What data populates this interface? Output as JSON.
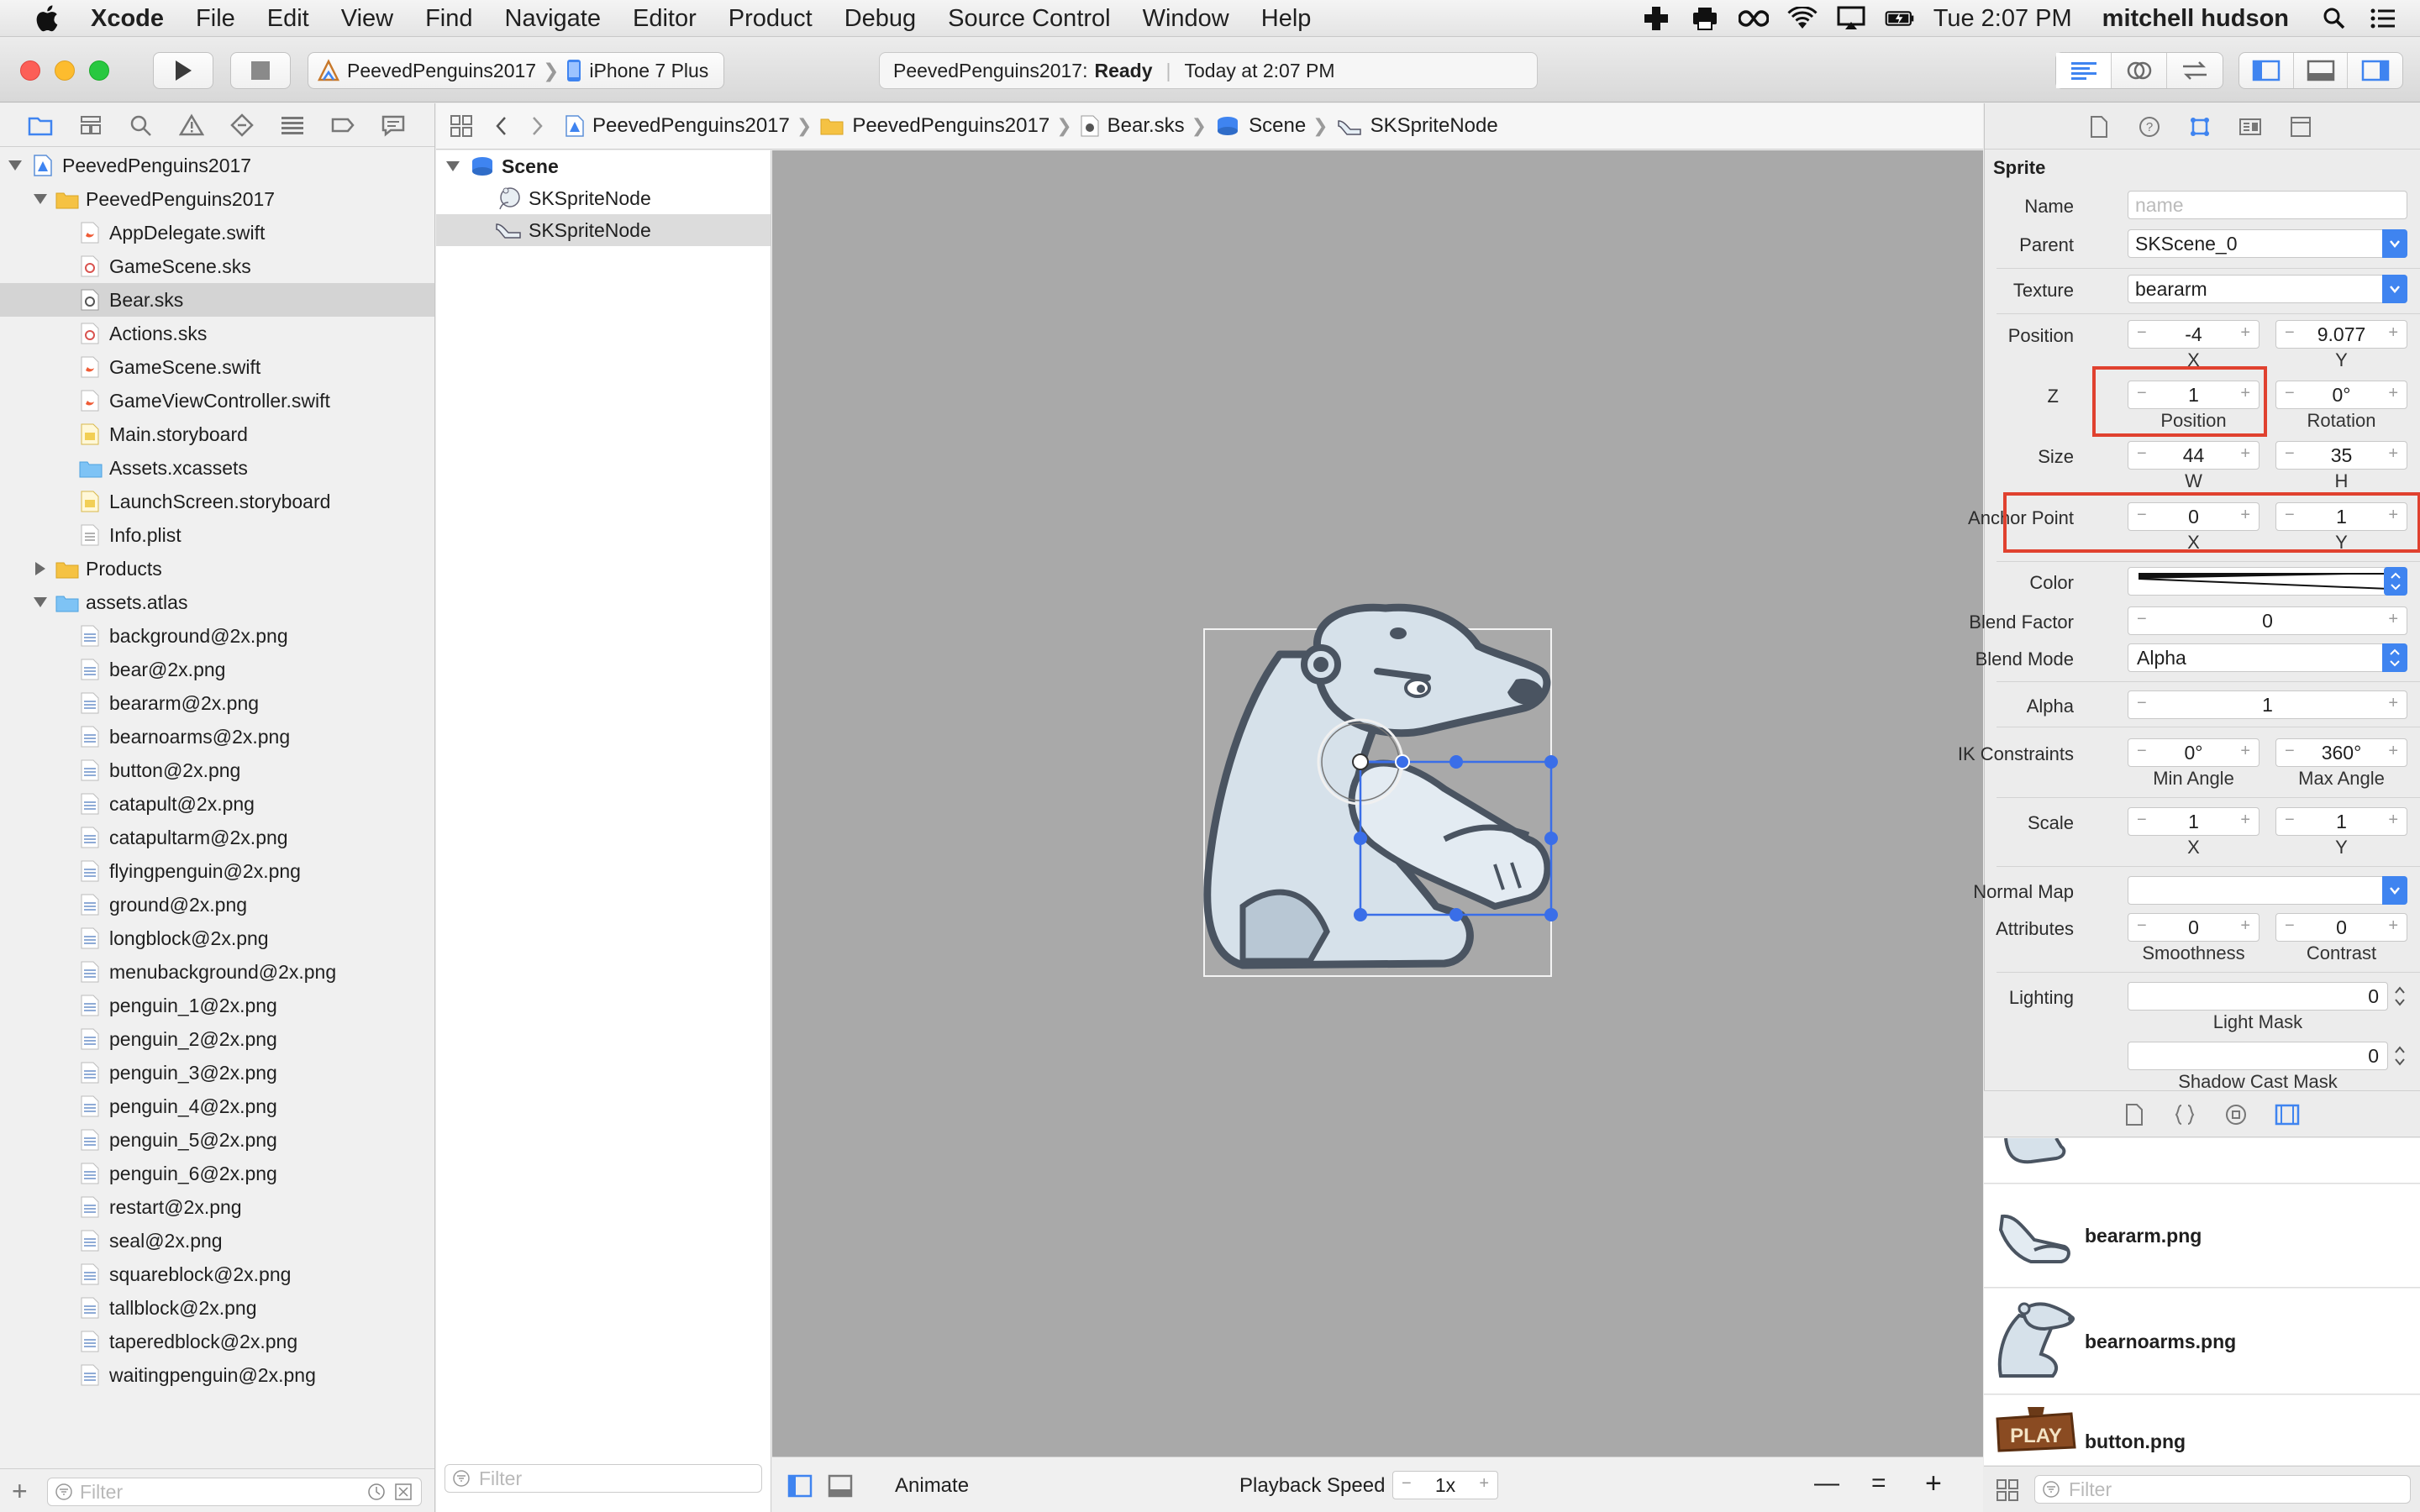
{
  "menubar": {
    "app_name": "Xcode",
    "menus": [
      "File",
      "Edit",
      "View",
      "Find",
      "Navigate",
      "Editor",
      "Product",
      "Debug",
      "Source Control",
      "Window",
      "Help"
    ],
    "clock": "Tue 2:07 PM",
    "user": "mitchell hudson"
  },
  "toolbar": {
    "scheme_project": "PeevedPenguins2017",
    "scheme_device": "iPhone 7 Plus",
    "activity_project": "PeevedPenguins2017:",
    "activity_status": "Ready",
    "activity_time": "Today at 2:07 PM"
  },
  "navigator": {
    "project": "PeevedPenguins2017",
    "group": "PeevedPenguins2017",
    "files": [
      {
        "name": "AppDelegate.swift",
        "kind": "swift"
      },
      {
        "name": "GameScene.sks",
        "kind": "sks"
      },
      {
        "name": "Bear.sks",
        "kind": "sks"
      },
      {
        "name": "Actions.sks",
        "kind": "sks"
      },
      {
        "name": "GameScene.swift",
        "kind": "swift"
      },
      {
        "name": "GameViewController.swift",
        "kind": "swift"
      },
      {
        "name": "Main.storyboard",
        "kind": "storyboard"
      },
      {
        "name": "Assets.xcassets",
        "kind": "assets"
      },
      {
        "name": "LaunchScreen.storyboard",
        "kind": "storyboard"
      },
      {
        "name": "Info.plist",
        "kind": "plist"
      }
    ],
    "products": "Products",
    "atlas": "assets.atlas",
    "atlas_files": [
      "background@2x.png",
      "bear@2x.png",
      "beararm@2x.png",
      "bearnoarms@2x.png",
      "button@2x.png",
      "catapult@2x.png",
      "catapultarm@2x.png",
      "flyingpenguin@2x.png",
      "ground@2x.png",
      "longblock@2x.png",
      "menubackground@2x.png",
      "penguin_1@2x.png",
      "penguin_2@2x.png",
      "penguin_3@2x.png",
      "penguin_4@2x.png",
      "penguin_5@2x.png",
      "penguin_6@2x.png",
      "restart@2x.png",
      "seal@2x.png",
      "squareblock@2x.png",
      "tallblock@2x.png",
      "taperedblock@2x.png",
      "waitingpenguin@2x.png"
    ],
    "filter_placeholder": "Filter"
  },
  "jumpbar": {
    "crumbs": [
      "PeevedPenguins2017",
      "PeevedPenguins2017",
      "Bear.sks",
      "Scene",
      "SKSpriteNode"
    ]
  },
  "outline": {
    "scene": "Scene",
    "nodes": [
      "SKSpriteNode",
      "SKSpriteNode"
    ],
    "filter_placeholder": "Filter"
  },
  "canvas": {
    "animate_label": "Animate",
    "playback_label": "Playback Speed",
    "playback_value": "1x",
    "zoom_out": "—",
    "zoom_fit": "=",
    "zoom_in": "+"
  },
  "inspector": {
    "section": "Sprite",
    "name_label": "Name",
    "name_placeholder": "name",
    "parent_label": "Parent",
    "parent_value": "SKScene_0",
    "texture_label": "Texture",
    "texture_value": "beararm",
    "position_label": "Position",
    "position_x": "-4",
    "position_y": "9.077",
    "x_label": "X",
    "y_label": "Y",
    "z_label": "Z",
    "z_position": "1",
    "z_position_sublabel": "Position",
    "rotation": "0°",
    "rotation_sublabel": "Rotation",
    "size_label": "Size",
    "size_w": "44",
    "size_h": "35",
    "w_label": "W",
    "h_label": "H",
    "anchor_label": "Anchor Point",
    "anchor_x": "0",
    "anchor_y": "1",
    "color_label": "Color",
    "blend_factor_label": "Blend Factor",
    "blend_factor": "0",
    "blend_mode_label": "Blend Mode",
    "blend_mode": "Alpha",
    "alpha_label": "Alpha",
    "alpha": "1",
    "ik_label": "IK Constraints",
    "ik_min": "0°",
    "ik_max": "360°",
    "min_angle_label": "Min Angle",
    "max_angle_label": "Max Angle",
    "scale_label": "Scale",
    "scale_x": "1",
    "scale_y": "1",
    "normal_map_label": "Normal Map",
    "attributes_label": "Attributes",
    "smoothness": "0",
    "contrast": "0",
    "smoothness_label": "Smoothness",
    "contrast_label": "Contrast",
    "lighting_label": "Lighting",
    "light_mask": "0",
    "light_mask_label": "Light Mask",
    "shadow_cast_mask": "0",
    "shadow_cast_mask_label": "Shadow Cast Mask",
    "step_minus": "−",
    "step_plus": "+"
  },
  "library": {
    "items": [
      "beararm.png",
      "bearnoarms.png",
      "button.png"
    ],
    "button_glyph_text": "PLAY",
    "filter_placeholder": "Filter"
  },
  "colors": {
    "accent": "#3f84f0",
    "highlight": "#e0412f",
    "canvas": "#a9a9a9",
    "selection_handle": "#3a6ee8"
  }
}
